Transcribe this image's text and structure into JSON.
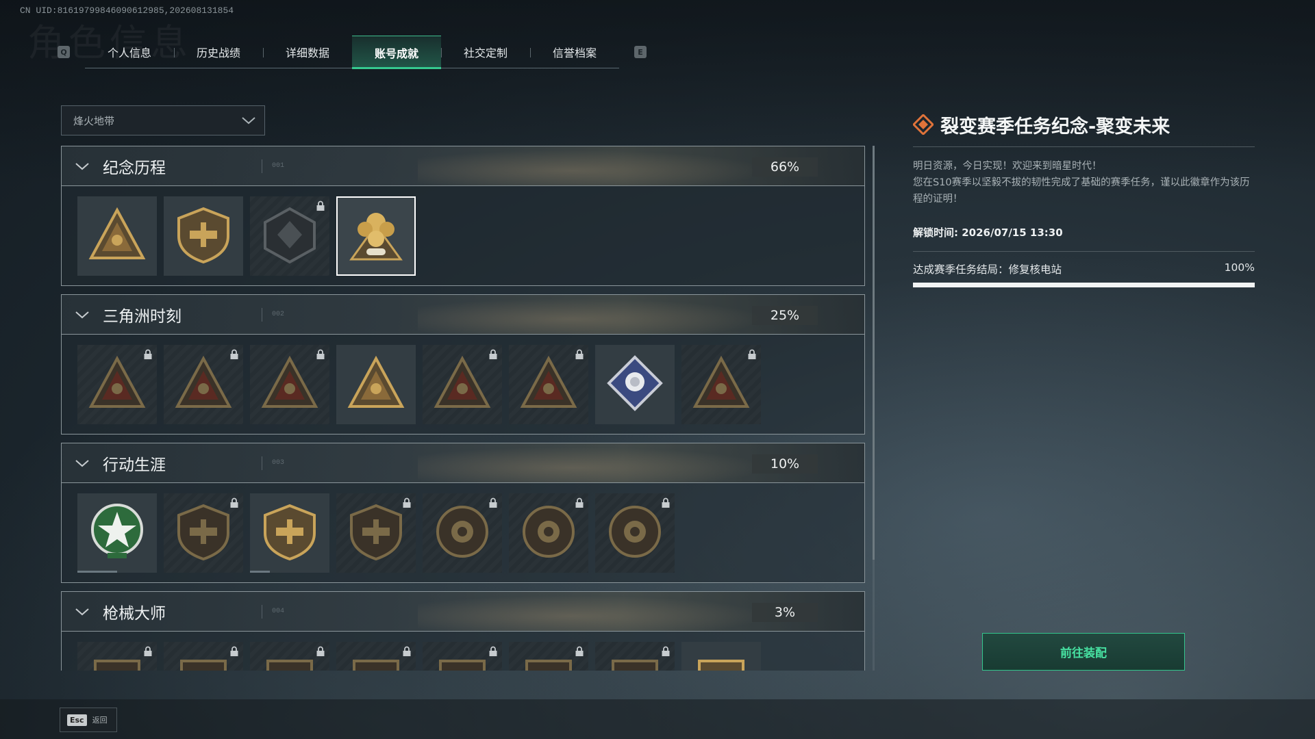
{
  "uid": "CN UID:8161979984609061​2985,202608131854",
  "watermark": "角色信息",
  "tabs": {
    "prev_key": "Q",
    "next_key": "E",
    "items": [
      "个人信息",
      "历史战绩",
      "详细数据",
      "账号成就",
      "社交定制",
      "信誉档案"
    ],
    "active_index": 3
  },
  "filter": {
    "selected": "烽火地带"
  },
  "categories": [
    {
      "title": "纪念历程",
      "code": "001",
      "percent": "66%",
      "badges": [
        {
          "icon": "triangle-emblem-icon",
          "locked": false
        },
        {
          "icon": "helicopter-shield-icon",
          "locked": false
        },
        {
          "icon": "hex-emblem-icon",
          "locked": true
        },
        {
          "icon": "gold-cluster-medal-icon",
          "locked": false,
          "selected": true
        }
      ]
    },
    {
      "title": "三角洲时刻",
      "code": "002",
      "percent": "25%",
      "badges": [
        {
          "icon": "triangle-robot-icon",
          "locked": true
        },
        {
          "icon": "triangle-runner-icon",
          "locked": true
        },
        {
          "icon": "triangle-hands-icon",
          "locked": true
        },
        {
          "icon": "triangle-squad-icon",
          "locked": false
        },
        {
          "icon": "triangle-beast-icon",
          "locked": true
        },
        {
          "icon": "triangle-fish-icon",
          "locked": true
        },
        {
          "icon": "diamond-rose-icon",
          "locked": false
        },
        {
          "icon": "triangle-swirl-icon",
          "locked": true
        }
      ]
    },
    {
      "title": "行动生涯",
      "code": "003",
      "percent": "10%",
      "badges": [
        {
          "icon": "green-star-wreath-icon",
          "locked": false,
          "progress": 0.5
        },
        {
          "icon": "shield-wing-icon",
          "locked": true
        },
        {
          "icon": "shield-split-icon",
          "locked": false,
          "progress": 0.25
        },
        {
          "icon": "shield-hex-icon",
          "locked": true
        },
        {
          "icon": "round-helmet-icon",
          "locked": true
        },
        {
          "icon": "round-skull-icon",
          "locked": true
        },
        {
          "icon": "round-eye-icon",
          "locked": true
        }
      ]
    },
    {
      "title": "枪械大师",
      "code": "004",
      "percent": "3%",
      "badges": [
        {
          "icon": "gun-shield-icon",
          "locked": true
        },
        {
          "icon": "gun-shield-icon",
          "locked": true
        },
        {
          "icon": "gun-shield-icon",
          "locked": true
        },
        {
          "icon": "gun-shield-icon",
          "locked": true
        },
        {
          "icon": "gun-shield-icon",
          "locked": true
        },
        {
          "icon": "gun-shield-icon",
          "locked": true
        },
        {
          "icon": "gun-shield-icon",
          "locked": true
        },
        {
          "icon": "gun-shield-icon",
          "locked": false
        }
      ]
    }
  ],
  "detail": {
    "title": "裂变赛季任务纪念-聚变未来",
    "desc_line1": "明日资源，今日实现！欢迎来到暗星时代！",
    "desc_line2": "您在S10赛季以坚毅不拔的韧性完成了基础的赛季任务，谨以此徽章作为该历程的证明！",
    "unlock_time": "解锁时间: 2026/07/15 13:30",
    "task_label": "达成赛季任务结局：修复核电站",
    "task_percent": "100%",
    "task_progress": 1.0
  },
  "equip_button": "前往装配",
  "back": {
    "key": "Esc",
    "label": "返回"
  },
  "colors": {
    "accent": "#35c98f",
    "gold": "#c9a45a",
    "title_icon": "#e0733a"
  }
}
